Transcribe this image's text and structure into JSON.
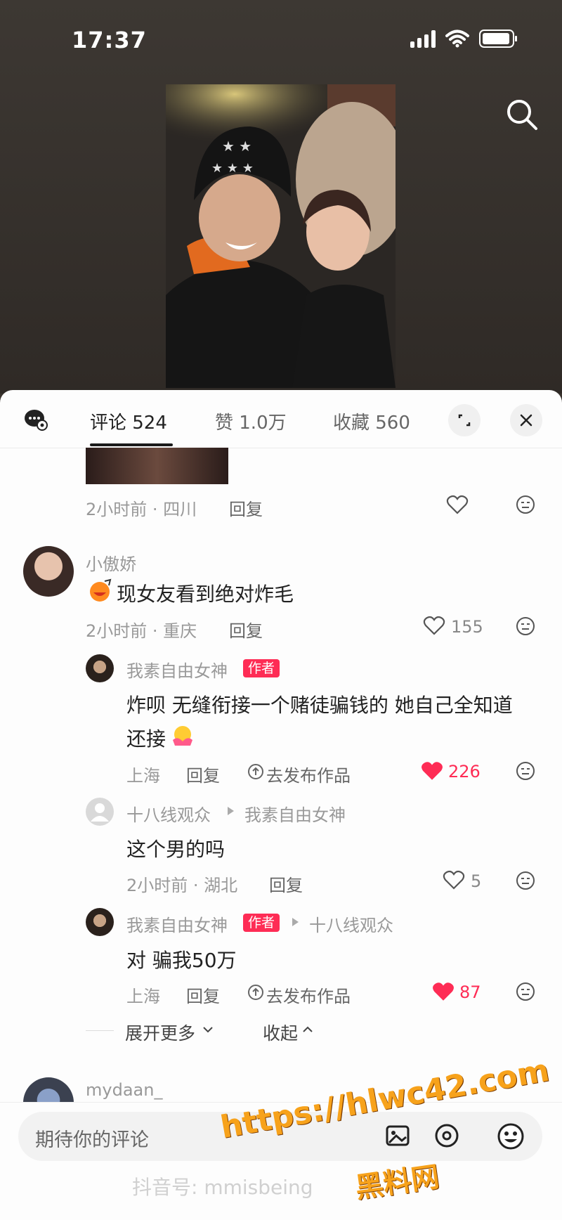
{
  "status": {
    "time": "17:37"
  },
  "tabs": {
    "comments": "评论 524",
    "likes": "赞 1.0万",
    "favorites": "收藏 560"
  },
  "partial_comment": {
    "meta": "2小时前 · 四川",
    "reply": "回复"
  },
  "comments": [
    {
      "user": "小傲娇",
      "text": "现女友看到绝对炸毛",
      "meta": "2小时前 · 重庆",
      "reply": "回复",
      "likes": "155"
    }
  ],
  "replies": [
    {
      "user": "我素自由女神",
      "badge": "作者",
      "text_line1": "炸呗 无缝衔接一个赌徒骗钱的 她自己全知道",
      "text_line2": "还接",
      "meta": "上海",
      "reply": "回复",
      "publish": "去发布作品",
      "likes": "226"
    },
    {
      "user": "十八线观众",
      "reply_to": "我素自由女神",
      "text": "这个男的吗",
      "meta": "2小时前 · 湖北",
      "reply": "回复",
      "likes": "5"
    },
    {
      "user": "我素自由女神",
      "badge": "作者",
      "reply_to": "十八线观众",
      "text": "对 骗我50万",
      "meta": "上海",
      "reply": "回复",
      "publish": "去发布作品",
      "likes": "87"
    }
  ],
  "expand": {
    "more": "展开更多",
    "collapse": "收起"
  },
  "next_comment": {
    "user": "mydaan_"
  },
  "input": {
    "placeholder": "期待你的评论"
  },
  "watermark": {
    "url": "https://hlwc42.com",
    "site": "黑料网",
    "douyin": "抖音号: mmisbeing"
  },
  "colors": {
    "accent": "#fe2c55",
    "watermark": "#f7a21b"
  }
}
